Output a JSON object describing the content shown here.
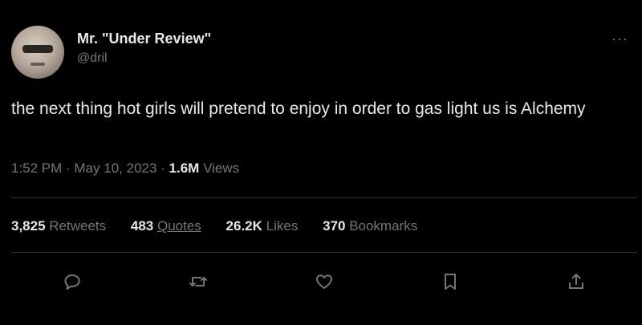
{
  "user": {
    "display_name": "Mr. \"Under Review\"",
    "handle": "@dril"
  },
  "more_label": "···",
  "tweet": {
    "text": "the next thing hot girls will pretend to enjoy in order to gas light us is Alchemy"
  },
  "meta": {
    "time": "1:52 PM",
    "separator1": " · ",
    "date": "May 10, 2023",
    "separator2": " · ",
    "views_count": "1.6M",
    "views_label": "Views"
  },
  "stats": {
    "retweets": {
      "count": "3,825",
      "label": "Retweets"
    },
    "quotes": {
      "count": "483",
      "label": "Quotes"
    },
    "likes": {
      "count": "26.2K",
      "label": "Likes"
    },
    "bookmarks": {
      "count": "370",
      "label": "Bookmarks"
    }
  },
  "actions": [
    {
      "icon": "reply-icon"
    },
    {
      "icon": "retweet-icon"
    },
    {
      "icon": "like-icon"
    },
    {
      "icon": "bookmark-icon"
    },
    {
      "icon": "share-icon"
    }
  ],
  "colors": {
    "background": "#000000",
    "text": "#e7e9ea",
    "secondary": "#71767b",
    "divider": "#2f3336"
  }
}
